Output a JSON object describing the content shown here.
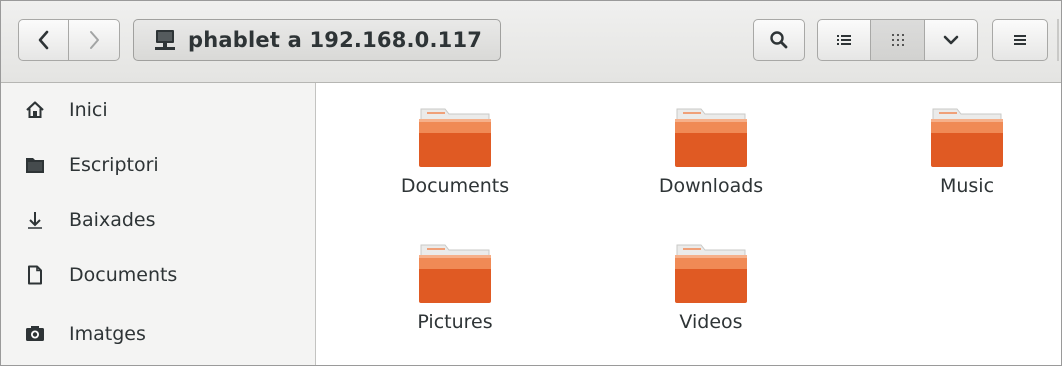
{
  "header": {
    "location": "phablet a 192.168.0.117"
  },
  "icons": {
    "back": "chevron-left-icon",
    "forward": "chevron-right-icon",
    "location": "network-computer-icon",
    "search": "search-icon",
    "list_view": "list-view-icon",
    "grid_view": "grid-view-icon",
    "view_options": "chevron-down-icon",
    "menu": "hamburger-menu-icon"
  },
  "sidebar": {
    "items": [
      {
        "label": "Inici",
        "icon": "home-icon"
      },
      {
        "label": "Escriptori",
        "icon": "desktop-folder-icon"
      },
      {
        "label": "Baixades",
        "icon": "download-icon"
      },
      {
        "label": "Documents",
        "icon": "document-icon"
      },
      {
        "label": "Imatges",
        "icon": "camera-icon"
      }
    ]
  },
  "files": [
    {
      "name": "Documents",
      "type": "folder"
    },
    {
      "name": "Downloads",
      "type": "folder"
    },
    {
      "name": "Music",
      "type": "folder"
    },
    {
      "name": "Pictures",
      "type": "folder"
    },
    {
      "name": "Videos",
      "type": "folder"
    }
  ],
  "colors": {
    "folder_top": "#f2a57a",
    "folder_body": "#e05a23",
    "folder_tab": "#ebebea",
    "text": "#2e3436"
  }
}
